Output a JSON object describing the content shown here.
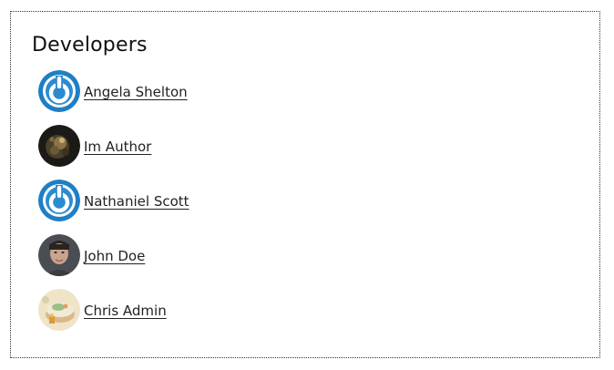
{
  "widget": {
    "title": "Developers"
  },
  "developers": [
    {
      "name": "Angela Shelton",
      "avatar": "power-logo-avatar"
    },
    {
      "name": "Im Author",
      "avatar": "dark-art-avatar"
    },
    {
      "name": "Nathaniel Scott",
      "avatar": "power-logo-avatar"
    },
    {
      "name": "John Doe",
      "avatar": "photo-avatar"
    },
    {
      "name": "Chris Admin",
      "avatar": "cake-avatar"
    }
  ],
  "colors": {
    "power_blue": "#1f7fc4",
    "link": "#222222"
  }
}
